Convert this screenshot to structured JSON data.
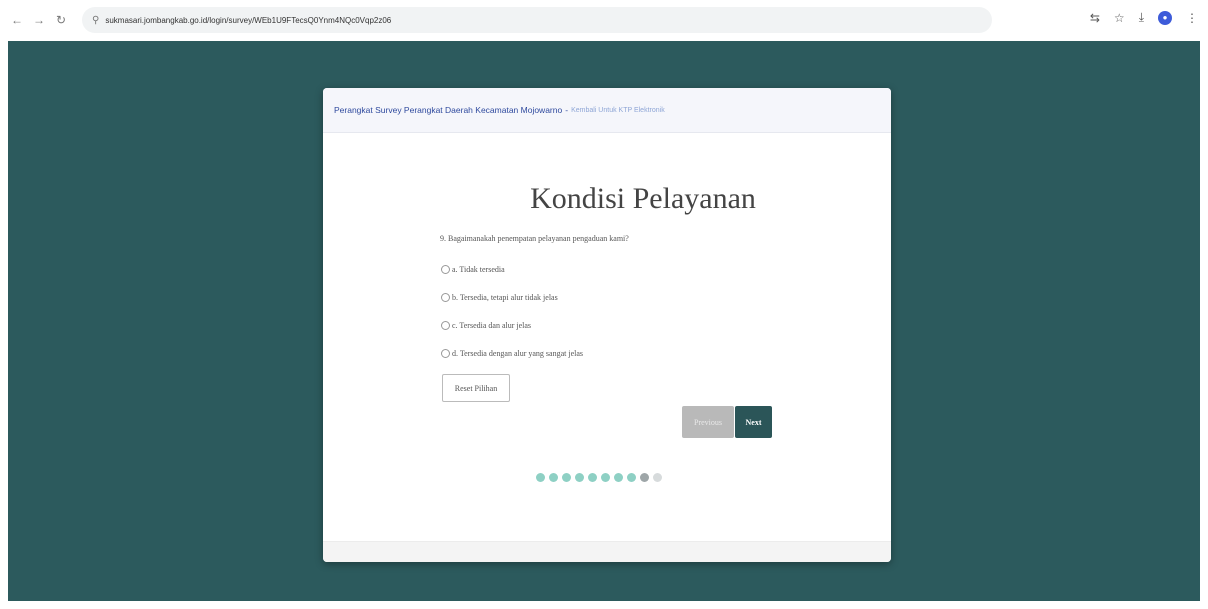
{
  "browser": {
    "url": "sukmasari.jombangkab.go.id/login/survey/WEb1U9FTecsQ0Ynm4NQc0Vqp2z06"
  },
  "survey": {
    "header_title": "Perangkat Survey Perangkat Daerah Kecamatan Mojowarno",
    "header_separator": "-",
    "header_subtitle": "Kembali Untuk KTP Elektronik",
    "section_title": "Kondisi Pelayanan",
    "question": "9. Bagaimanakah penempatan pelayanan pengaduan kami?",
    "options": [
      {
        "label": "a. Tidak tersedia"
      },
      {
        "label": "b. Tersedia, tetapi alur tidak jelas"
      },
      {
        "label": "c. Tersedia dan alur jelas"
      },
      {
        "label": "d. Tersedia dengan alur yang sangat jelas"
      }
    ],
    "reset_label": "Reset Pilihan",
    "previous_label": "Previous",
    "next_label": "Next",
    "progress": {
      "total_steps": 10,
      "completed_steps": 9
    }
  },
  "colors": {
    "page_background": "#2c5a5d",
    "next_button": "#2b5558",
    "progress_done": "#8ed0c4",
    "header_title": "#2f4a9e"
  }
}
